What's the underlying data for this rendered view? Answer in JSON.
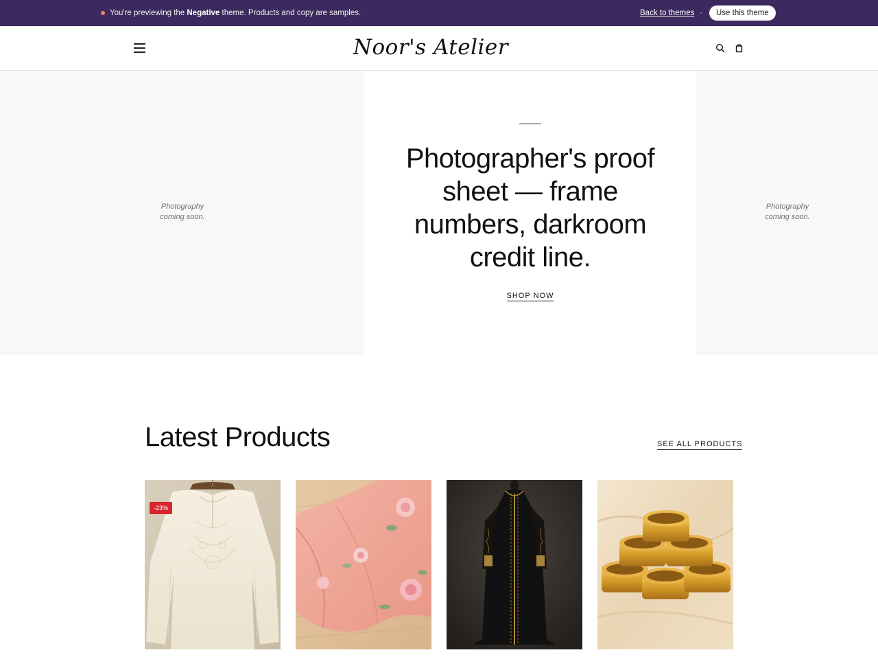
{
  "preview_bar": {
    "text_prefix": "You're previewing the ",
    "theme_name": "Negative",
    "text_suffix": " theme. Products and copy are samples.",
    "back_label": "Back to themes",
    "use_label": "Use this theme"
  },
  "header": {
    "logo": "Noor's Atelier",
    "icons": [
      "menu-icon",
      "search-icon",
      "bag-icon"
    ]
  },
  "hero": {
    "title": "Photographer's proof sheet — frame numbers, darkroom credit line.",
    "cta": "SHOP NOW",
    "placeholder_line1": "Photography",
    "placeholder_line2": "coming soon."
  },
  "products_section": {
    "title": "Latest Products",
    "see_all": "SEE ALL PRODUCTS",
    "products": [
      {
        "badge": "-23%",
        "image": "cream-embroidered-tunic"
      },
      {
        "badge": "",
        "image": "pink-floral-scarf"
      },
      {
        "badge": "",
        "image": "black-embroidered-abaya"
      },
      {
        "badge": "",
        "image": "gold-bangles"
      }
    ]
  },
  "colors": {
    "banner_bg": "#3c2a5e",
    "sale_badge": "#d9262c",
    "placeholder_bg": "#f8f8f8"
  }
}
